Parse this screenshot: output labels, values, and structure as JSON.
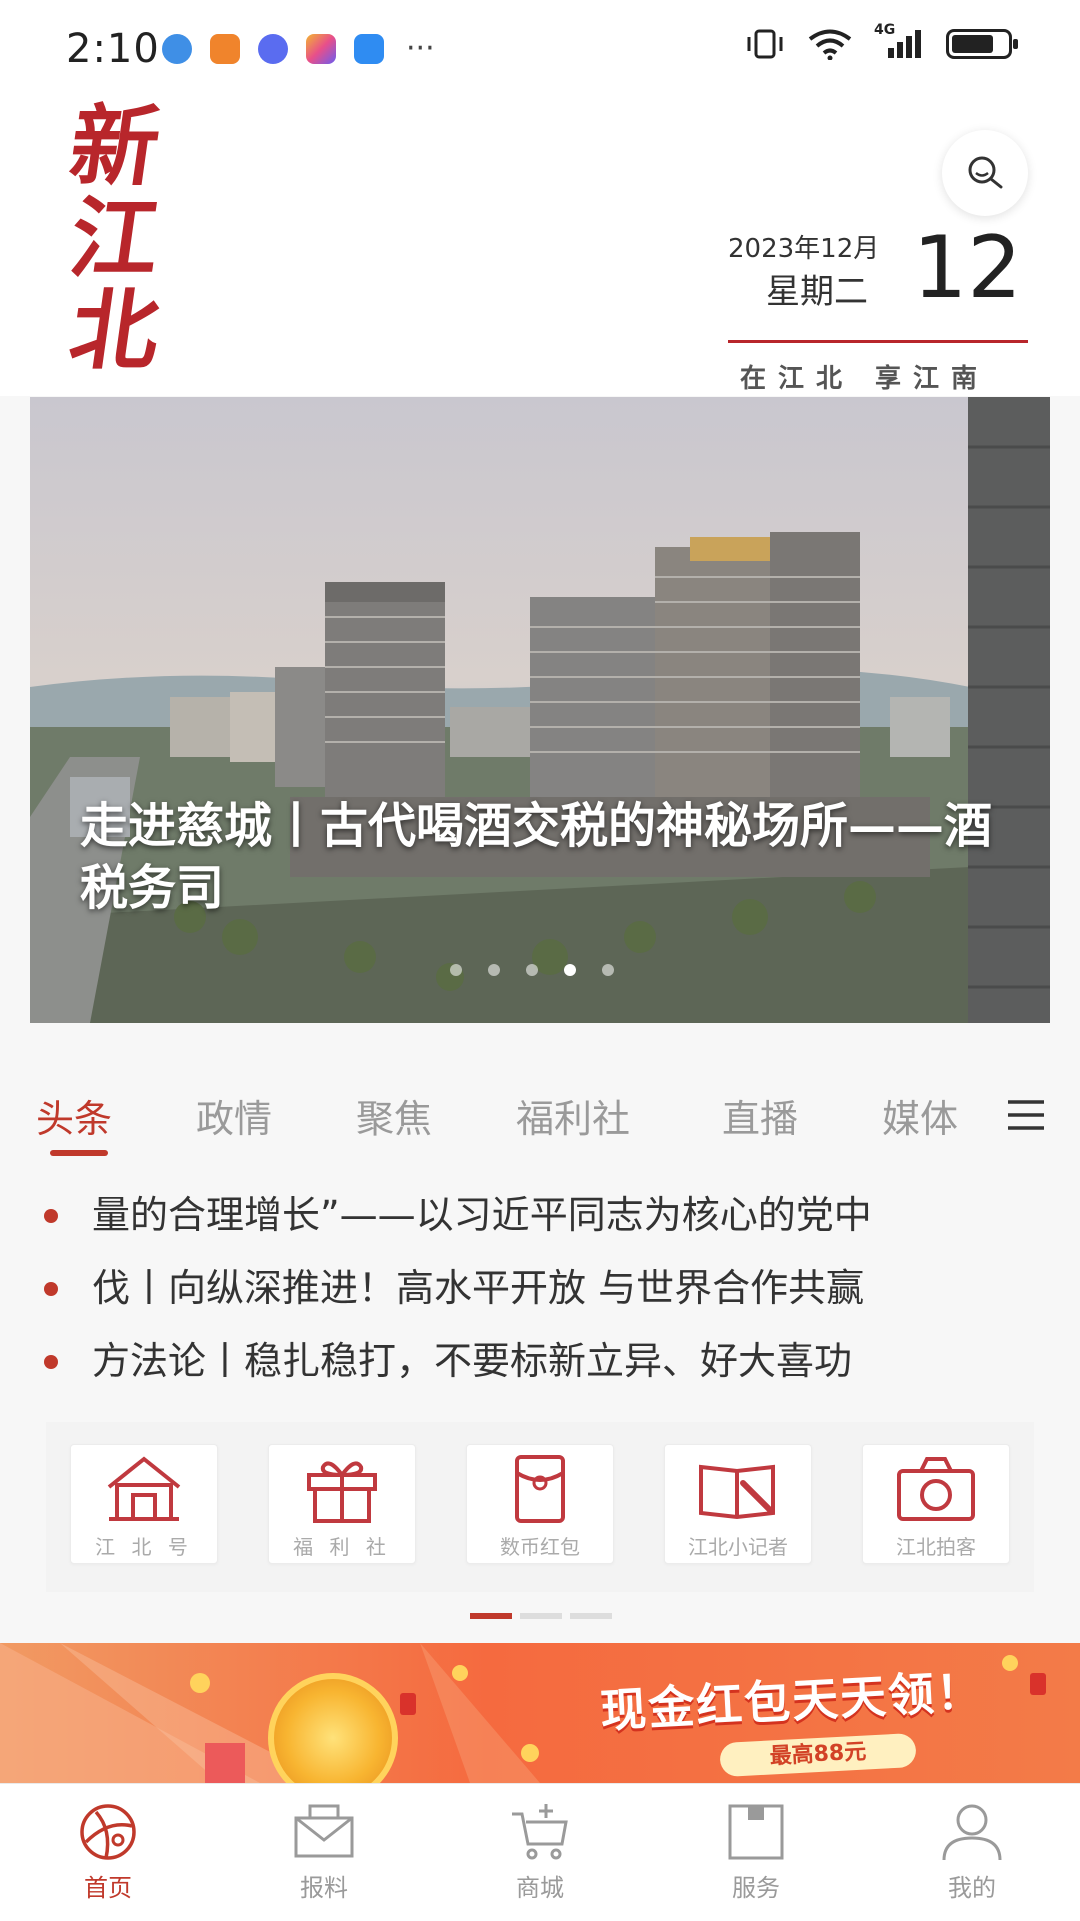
{
  "status_bar": {
    "time": "2:10",
    "more": "···",
    "network": "4G",
    "battery_level": 0.75,
    "app_icon_colors": [
      "#3f8fe6",
      "#f0842c",
      "#5a6cf0",
      "#e84f8a",
      "#2f8cf2"
    ]
  },
  "header": {
    "logo_chars": [
      "新",
      "江",
      "北"
    ],
    "date": {
      "year_month": "2023年12月",
      "weekday": "星期二",
      "day": "12"
    },
    "slogan": "在江北  享江南"
  },
  "banner": {
    "caption": "走进慈城丨古代喝酒交税的神秘场所——酒税务司",
    "slide_count": 5,
    "active_slide": 4
  },
  "tabs": {
    "items": [
      "头条",
      "政情",
      "聚焦",
      "福利社",
      "直播",
      "媒体"
    ],
    "active_index": 0
  },
  "headlines": [
    "量的合理增长”——以习近平同志为核心的党中",
    "伐丨向纵深推进！高水平开放 与世界合作共赢",
    "方法论丨稳扎稳打，不要标新立异、好大喜功"
  ],
  "quick_entries": [
    {
      "label": "江 北 号",
      "icon": "house-icon"
    },
    {
      "label": "福 利 社",
      "icon": "gift-icon"
    },
    {
      "label": "数币红包",
      "icon": "red-envelope-icon"
    },
    {
      "label": "江北小记者",
      "icon": "book-pen-icon"
    },
    {
      "label": "江北拍客",
      "icon": "camera-icon"
    }
  ],
  "quick_pager": {
    "pages": 3,
    "active": 0
  },
  "promo": {
    "title": "现金红包天天领！",
    "subtitle": "最高88元"
  },
  "bottom_nav": {
    "items": [
      {
        "label": "首页",
        "icon": "home-globe-icon"
      },
      {
        "label": "报料",
        "icon": "mail-icon"
      },
      {
        "label": "商城",
        "icon": "cart-icon"
      },
      {
        "label": "服务",
        "icon": "service-box-icon"
      },
      {
        "label": "我的",
        "icon": "user-icon"
      }
    ],
    "active_index": 0
  },
  "colors": {
    "accent": "#c0392b",
    "logo": "#b8262b",
    "inactive_text": "#9a9a9a"
  }
}
